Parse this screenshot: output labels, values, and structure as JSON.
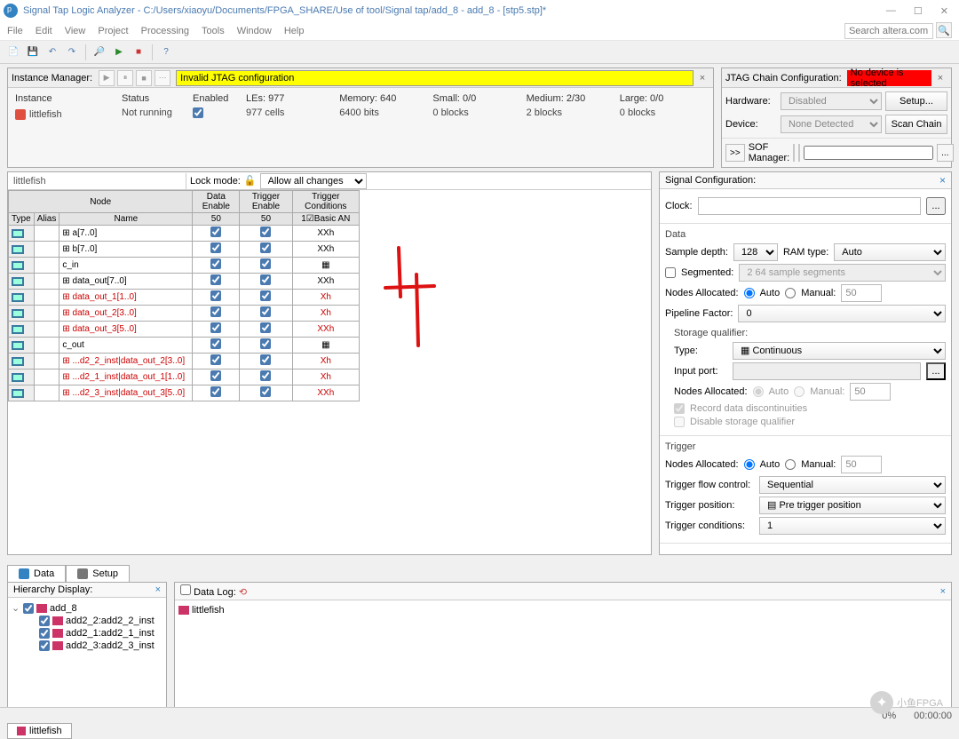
{
  "window": {
    "title": "Signal Tap Logic Analyzer - C:/Users/xiaoyu/Documents/FPGA_SHARE/Use of tool/Signal tap/add_8 - add_8 - [stp5.stp]*"
  },
  "menu": {
    "file": "File",
    "edit": "Edit",
    "view": "View",
    "project": "Project",
    "processing": "Processing",
    "tools": "Tools",
    "window": "Window",
    "help": "Help",
    "search_placeholder": "Search altera.com"
  },
  "instanceManager": {
    "label": "Instance Manager:",
    "warning": "Invalid JTAG configuration",
    "headers": {
      "instance": "Instance",
      "status": "Status",
      "enabled": "Enabled",
      "les": "LEs: 977",
      "memory": "Memory: 640",
      "small": "Small: 0/0",
      "medium": "Medium: 2/30",
      "large": "Large: 0/0"
    },
    "row": {
      "name": "littlefish",
      "status": "Not running",
      "les": "977 cells",
      "memory": "6400 bits",
      "small": "0 blocks",
      "medium": "2 blocks",
      "large": "0 blocks"
    }
  },
  "jtag": {
    "label": "JTAG Chain Configuration:",
    "warning": "No device is selected",
    "hardware_label": "Hardware:",
    "hardware_val": "Disabled",
    "setup_btn": "Setup...",
    "device_label": "Device:",
    "device_val": "None Detected",
    "scan_btn": "Scan Chain",
    "sof_label": "SOF Manager:"
  },
  "nodeList": {
    "instance_name": "littlefish",
    "lock_label": "Lock mode:",
    "lock_val": "Allow all changes",
    "hdr": {
      "node": "Node",
      "type": "Type",
      "alias": "Alias",
      "name": "Name",
      "de": "Data Enable",
      "te": "Trigger Enable",
      "tc": "Trigger Conditions",
      "de50": "50",
      "te50": "50",
      "ba": "1☑Basic AN"
    },
    "rows": [
      {
        "name": "a[7..0]",
        "tc": "XXh",
        "red": false,
        "exp": true
      },
      {
        "name": "b[7..0]",
        "tc": "XXh",
        "red": false,
        "exp": true
      },
      {
        "name": "c_in",
        "tc": "▦",
        "red": false,
        "exp": false
      },
      {
        "name": "data_out[7..0]",
        "tc": "XXh",
        "red": false,
        "exp": true
      },
      {
        "name": "data_out_1[1..0]",
        "tc": "Xh",
        "red": true,
        "exp": true
      },
      {
        "name": "data_out_2[3..0]",
        "tc": "Xh",
        "red": true,
        "exp": true
      },
      {
        "name": "data_out_3[5..0]",
        "tc": "XXh",
        "red": true,
        "exp": true
      },
      {
        "name": "c_out",
        "tc": "▦",
        "red": false,
        "exp": false
      },
      {
        "name": "...d2_2_inst|data_out_2[3..0]",
        "tc": "Xh",
        "red": true,
        "exp": true
      },
      {
        "name": "...d2_1_inst|data_out_1[1..0]",
        "tc": "Xh",
        "red": true,
        "exp": true
      },
      {
        "name": "...d2_3_inst|data_out_3[5..0]",
        "tc": "XXh",
        "red": true,
        "exp": true
      }
    ]
  },
  "signalConfig": {
    "title": "Signal Configuration:",
    "clock_label": "Clock:",
    "data_title": "Data",
    "sample_depth_label": "Sample depth:",
    "sample_depth_val": "128",
    "ramtype_label": "RAM type:",
    "ramtype_val": "Auto",
    "segmented_label": "Segmented:",
    "segmented_val": "2  64 sample segments",
    "nodes_alloc_label": "Nodes Allocated:",
    "auto": "Auto",
    "manual": "Manual:",
    "manual_val": "50",
    "pipeline_label": "Pipeline Factor:",
    "pipeline_val": "0",
    "storage_q_title": "Storage qualifier:",
    "type_label": "Type:",
    "type_val": "▦ Continuous",
    "input_port_label": "Input port:",
    "record_disc": "Record data discontinuities",
    "disable_sq": "Disable storage qualifier",
    "trigger_title": "Trigger",
    "flow_label": "Trigger flow control:",
    "flow_val": "Sequential",
    "pos_label": "Trigger position:",
    "pos_val": "▤ Pre trigger position",
    "cond_label": "Trigger conditions:",
    "cond_val": "1"
  },
  "tabs": {
    "data": "Data",
    "setup": "Setup"
  },
  "hier": {
    "title": "Hierarchy Display:",
    "root": "add_8",
    "children": [
      "add2_2:add2_2_inst",
      "add2_1:add2_1_inst",
      "add2_3:add2_3_inst"
    ]
  },
  "datalog": {
    "title": "Data Log:",
    "item": "littlefish"
  },
  "status": {
    "pct": "0%",
    "time": "00:00:00"
  },
  "bottomtab": {
    "name": "littlefish"
  },
  "watermark": {
    "text": "小鱼FPGA"
  }
}
